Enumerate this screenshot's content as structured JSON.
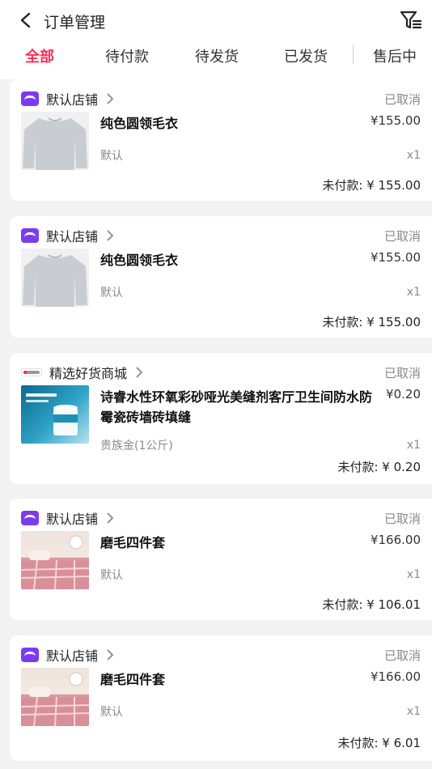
{
  "header": {
    "title": "订单管理",
    "back_icon": "chevron-left-icon",
    "filter_icon": "filter-icon"
  },
  "tabs": [
    {
      "label": "全部",
      "active": true
    },
    {
      "label": "待付款",
      "active": false
    },
    {
      "label": "待发货",
      "active": false
    },
    {
      "label": "已发货",
      "active": false
    },
    {
      "label": "售后中",
      "active": false
    }
  ],
  "colors": {
    "accent": "#ff2c55",
    "store_logo": "#7b3cf0"
  },
  "orders": [
    {
      "store": "默认店铺",
      "status": "已取消",
      "product": "纯色圆领毛衣",
      "price": "¥155.00",
      "variant": "默认",
      "qty": "x1",
      "unpaid_label": "未付款: ¥ 155.00"
    },
    {
      "store": "默认店铺",
      "status": "已取消",
      "product": "纯色圆领毛衣",
      "price": "¥155.00",
      "variant": "默认",
      "qty": "x1",
      "unpaid_label": "未付款: ¥ 155.00"
    },
    {
      "store": "精选好货商城",
      "status": "已取消",
      "product": "诗睿水性环氧彩砂哑光美缝剂客厅卫生间防水防霉瓷砖墙砖填缝",
      "price": "¥0.20",
      "variant": "贵族金(1公斤)",
      "qty": "x1",
      "unpaid_label": "未付款: ¥ 0.20"
    },
    {
      "store": "默认店铺",
      "status": "已取消",
      "product": "磨毛四件套",
      "price": "¥166.00",
      "variant": "默认",
      "qty": "x1",
      "unpaid_label": "未付款: ¥ 106.01"
    },
    {
      "store": "默认店铺",
      "status": "已取消",
      "product": "磨毛四件套",
      "price": "¥166.00",
      "variant": "默认",
      "qty": "x1",
      "unpaid_label": "未付款: ¥ 6.01"
    }
  ]
}
